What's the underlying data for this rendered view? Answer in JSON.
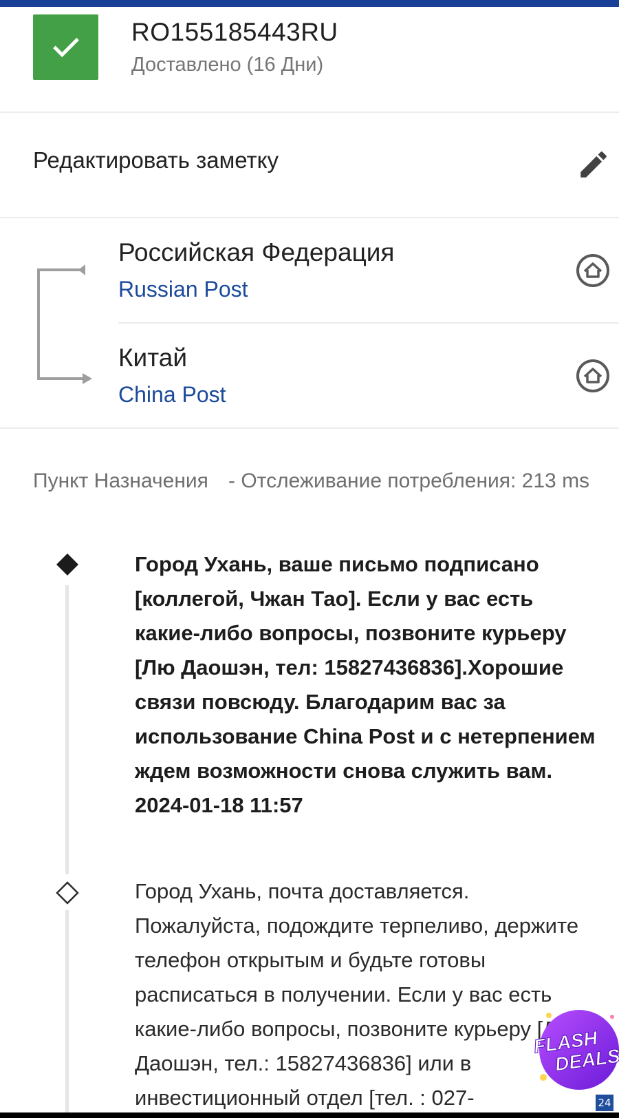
{
  "header": {
    "tracking_number": "RO155185443RU",
    "status": "Доставлено (16 Дни)",
    "status_color": "#43a047",
    "accent_color": "#1a3f96"
  },
  "note": {
    "label": "Редактировать заметку"
  },
  "route": {
    "origin": {
      "country": "Российская Федерация",
      "carrier": "Russian Post"
    },
    "destination": {
      "country": "Китай",
      "carrier": "China Post"
    }
  },
  "destination_info": {
    "label": "Пункт Назначения",
    "value": "- Отслеживание потребления: 213 ms"
  },
  "events": [
    {
      "text": "Город Ухань, ваше письмо подписано [коллегой, Чжан Тао]. Если у вас есть какие-либо вопросы, позвоните курьеру [Лю Даошэн, тел: 15827436836].Хорошие связи повсюду. Благодарим вас за использование China Post и с нетерпением ждем возможности снова служить вам.",
      "time": "2024-01-18 11:57",
      "latest": true
    },
    {
      "text": "Город Ухань, почта доставляется. Пожалуйста, подождите терпеливо, держите телефон открытым и будьте готовы расписаться в получении. Если у вас есть какие-либо вопросы, позвоните курьеру [Лю Даошэн, тел.: 15827436836] или в инвестиционный отдел [тел. : 027-",
      "latest": false
    }
  ],
  "promo": {
    "line1": "FLASH",
    "line2": "DEALS"
  },
  "corner_badge": "24"
}
